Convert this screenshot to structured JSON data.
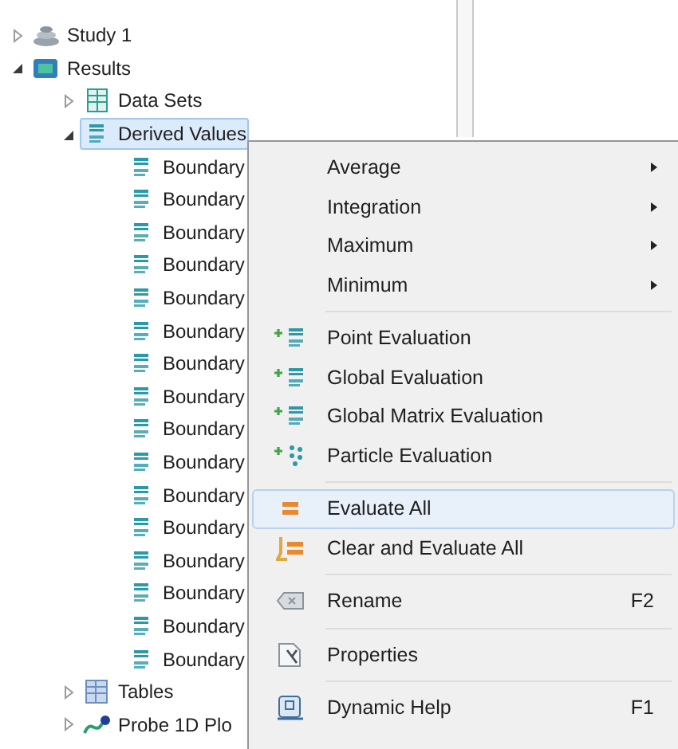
{
  "tree": [
    {
      "label": "Study 1",
      "kind": "study",
      "expanded": false,
      "selected": false
    },
    {
      "label": "Results",
      "kind": "results",
      "expanded": true,
      "selected": false,
      "children": [
        {
          "label": "Data Sets",
          "kind": "datasets",
          "expanded": false,
          "selected": false
        },
        {
          "label": "Derived Values",
          "kind": "value",
          "expanded": true,
          "selected": true,
          "children": [
            {
              "label": "Boundary",
              "kind": "value",
              "selected": false
            },
            {
              "label": "Boundary",
              "kind": "value",
              "selected": false
            },
            {
              "label": "Boundary",
              "kind": "value",
              "selected": false
            },
            {
              "label": "Boundary",
              "kind": "value",
              "selected": false
            },
            {
              "label": "Boundary",
              "kind": "value",
              "selected": false
            },
            {
              "label": "Boundary",
              "kind": "value",
              "selected": false
            },
            {
              "label": "Boundary",
              "kind": "value",
              "selected": false
            },
            {
              "label": "Boundary",
              "kind": "value",
              "selected": false
            },
            {
              "label": "Boundary",
              "kind": "value",
              "selected": false
            },
            {
              "label": "Boundary",
              "kind": "value",
              "selected": false
            },
            {
              "label": "Boundary",
              "kind": "value",
              "selected": false
            },
            {
              "label": "Boundary",
              "kind": "value",
              "selected": false
            },
            {
              "label": "Boundary",
              "kind": "value",
              "selected": false
            },
            {
              "label": "Boundary",
              "kind": "value",
              "selected": false
            },
            {
              "label": "Boundary",
              "kind": "value",
              "selected": false
            },
            {
              "label": "Boundary",
              "kind": "value",
              "selected": false
            }
          ]
        },
        {
          "label": "Tables",
          "kind": "tables",
          "expanded": false,
          "selected": false
        },
        {
          "label": "Probe 1D Plo",
          "kind": "plot",
          "expanded": false,
          "selected": false
        }
      ]
    }
  ],
  "context_menu": {
    "groups": [
      [
        {
          "label": "Average",
          "kind": "submenu",
          "selected": false
        },
        {
          "label": "Integration",
          "kind": "submenu",
          "selected": false
        },
        {
          "label": "Maximum",
          "kind": "submenu",
          "selected": false
        },
        {
          "label": "Minimum",
          "kind": "submenu",
          "selected": false
        }
      ],
      [
        {
          "label": "Point Evaluation",
          "kind": "evaluation",
          "selected": false
        },
        {
          "label": "Global Evaluation",
          "kind": "evaluation",
          "selected": false
        },
        {
          "label": "Global Matrix Evaluation",
          "kind": "evaluation",
          "selected": false
        },
        {
          "label": "Particle Evaluation",
          "kind": "particle",
          "selected": false
        }
      ],
      [
        {
          "label": "Evaluate All",
          "kind": "evaluate",
          "selected": true
        },
        {
          "label": "Clear and Evaluate All",
          "kind": "reevaluate",
          "selected": false
        }
      ],
      [
        {
          "label": "Rename",
          "kind": "rename",
          "shortcut": "F2",
          "selected": false
        }
      ],
      [
        {
          "label": "Properties",
          "kind": "properties",
          "selected": false
        }
      ],
      [
        {
          "label": "Dynamic Help",
          "kind": "help",
          "shortcut": "F1",
          "selected": false
        }
      ]
    ]
  }
}
